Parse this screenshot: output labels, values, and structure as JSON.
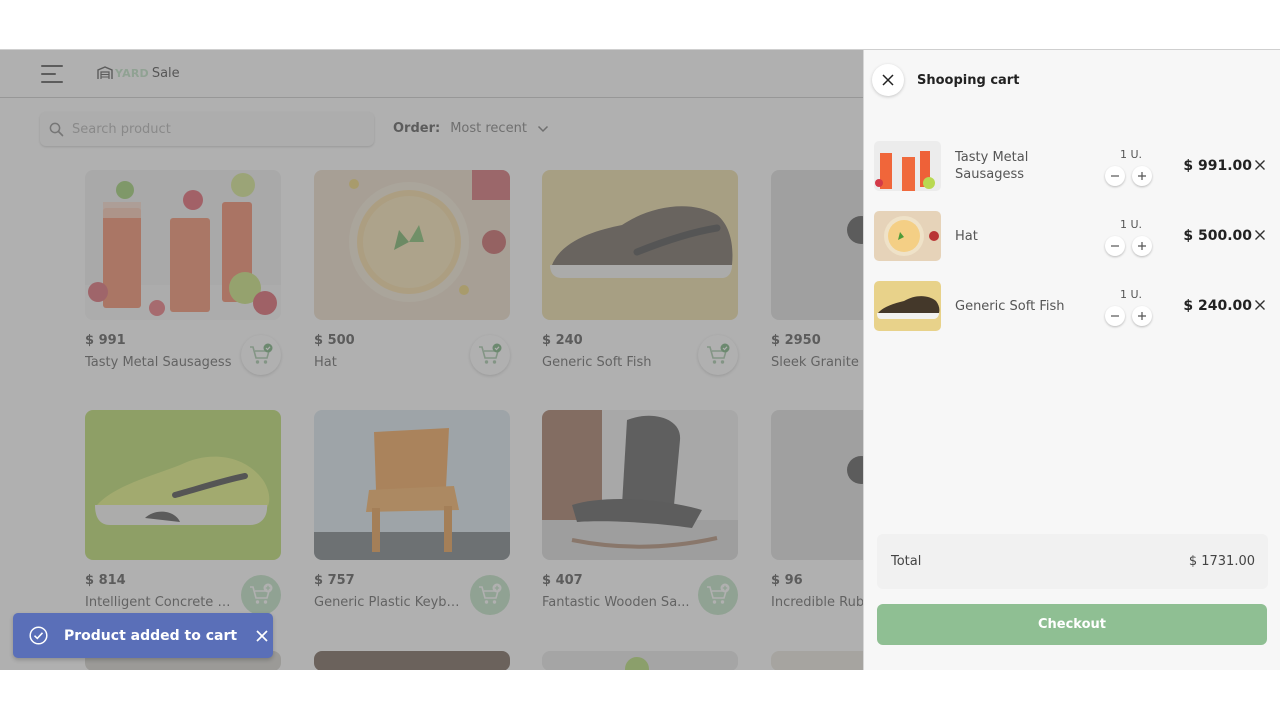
{
  "app": {
    "name_accent": "YARD",
    "name_rest": "Sale"
  },
  "search": {
    "placeholder": "Search product"
  },
  "order": {
    "label": "Order:",
    "value": "Most recent"
  },
  "products": [
    {
      "price": "$ 991",
      "name": "Tasty Metal Sausagess",
      "image": "drinks",
      "in_cart": true
    },
    {
      "price": "$ 500",
      "name": "Hat",
      "image": "pizza",
      "in_cart": true
    },
    {
      "price": "$ 240",
      "name": "Generic Soft Fish",
      "image": "shoe-brown",
      "in_cart": true
    },
    {
      "price": "$ 2950",
      "name": "Sleek Granite",
      "image": "concrete",
      "in_cart": false
    },
    {
      "price": "$ 814",
      "name": "Intelligent Concrete S...",
      "image": "shoe-green",
      "in_cart": false
    },
    {
      "price": "$ 757",
      "name": "Generic Plastic Keybo...",
      "image": "chair-orange",
      "in_cart": false
    },
    {
      "price": "$ 407",
      "name": "Fantastic Wooden Sa...",
      "image": "chair-black",
      "in_cart": false
    },
    {
      "price": "$ 96",
      "name": "Incredible Rub",
      "image": "concrete",
      "in_cart": false
    }
  ],
  "toast": {
    "message": "Product added to cart"
  },
  "cart": {
    "title": "Shooping cart",
    "items": [
      {
        "name": "Tasty Metal Sausagess",
        "qty": "1 U.",
        "price": "$ 991.00",
        "image": "drinks"
      },
      {
        "name": "Hat",
        "qty": "1 U.",
        "price": "$ 500.00",
        "image": "pizza"
      },
      {
        "name": "Generic Soft Fish",
        "qty": "1 U.",
        "price": "$ 240.00",
        "image": "shoe-brown"
      }
    ],
    "total_label": "Total",
    "total_value": "$ 1731.00",
    "checkout_label": "Checkout"
  },
  "colors": {
    "accent": "#acd9b2",
    "checkout": "#8fbf93",
    "toast": "#5a6fb8",
    "overlay": "#808080"
  }
}
